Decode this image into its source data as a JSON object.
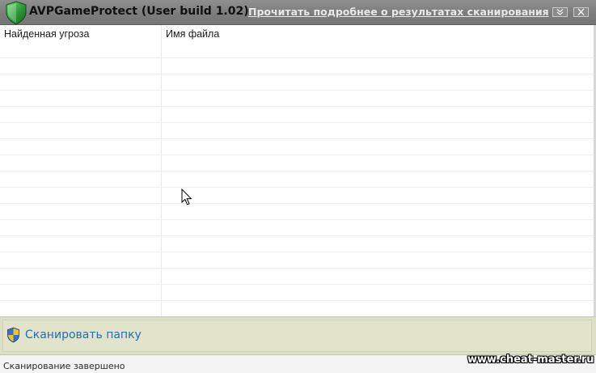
{
  "window": {
    "title": "AVPGameProtect (User build 1.02)",
    "details_link": "Прочитать подробнее о результатах сканирования",
    "app_icon": "green-shield-icon",
    "buttons": {
      "collapse_icon": "double-chevron-down-icon",
      "close_icon": "close-icon"
    }
  },
  "table": {
    "columns": [
      "Найденная угроза",
      "Имя файла"
    ],
    "rows": []
  },
  "scan_panel": {
    "icon": "uac-shield-icon",
    "label": "Сканировать папку"
  },
  "status_bar": {
    "text": "Сканирование завершено"
  },
  "watermark": "www.cheat-master.ru",
  "colors": {
    "titlebar": "#808080",
    "link": "#1f6fb5",
    "panel": "#dddfc6",
    "shield_green": "#2e9e3a"
  }
}
